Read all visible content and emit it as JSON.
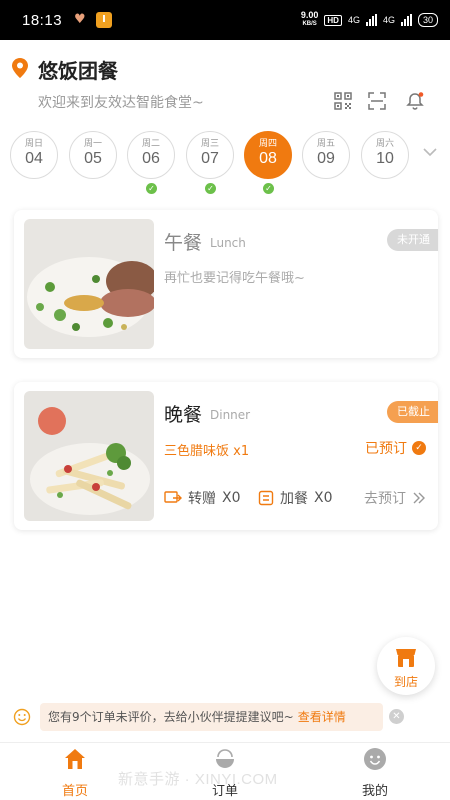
{
  "status_bar": {
    "time": "18:13",
    "app_badge": "I",
    "net_speed": "9.00",
    "net_unit": "KB/S",
    "hd": "HD",
    "net_4g_a": "4G",
    "net_4g_b": "4G",
    "battery": "30"
  },
  "header": {
    "shop_name": "悠饭团餐",
    "welcome": "欢迎来到友效达智能食堂~"
  },
  "dates": [
    {
      "weekday": "周日",
      "day": "04",
      "active": false,
      "checked": false
    },
    {
      "weekday": "周一",
      "day": "05",
      "active": false,
      "checked": false
    },
    {
      "weekday": "周二",
      "day": "06",
      "active": false,
      "checked": true
    },
    {
      "weekday": "周三",
      "day": "07",
      "active": false,
      "checked": true
    },
    {
      "weekday": "周四",
      "day": "08",
      "active": true,
      "checked": true
    },
    {
      "weekday": "周五",
      "day": "09",
      "active": false,
      "checked": false
    },
    {
      "weekday": "周六",
      "day": "10",
      "active": false,
      "checked": false
    }
  ],
  "lunch": {
    "title": "午餐",
    "title_en": "Lunch",
    "status": "未开通",
    "subtitle": "再忙也要记得吃午餐哦~"
  },
  "dinner": {
    "title": "晚餐",
    "title_en": "Dinner",
    "status": "已截止",
    "dish": "三色腊味饭 x1",
    "booked": "已预订",
    "transfer_label": "转赠",
    "transfer_count": "X0",
    "add_label": "加餐",
    "add_count": "X0",
    "go_book": "去预订"
  },
  "store_button": {
    "label": "到店"
  },
  "notice": {
    "text": "您有9个订单未评价，去给小伙伴提提建议吧~",
    "link": "查看详情"
  },
  "nav": {
    "home": "首页",
    "orders": "订单",
    "mine": "我的"
  },
  "watermark": "新意手游 · XINYI.COM",
  "colors": {
    "accent": "#f07a10",
    "check": "#6cc04a",
    "notice_bg": "#fbeee4"
  }
}
